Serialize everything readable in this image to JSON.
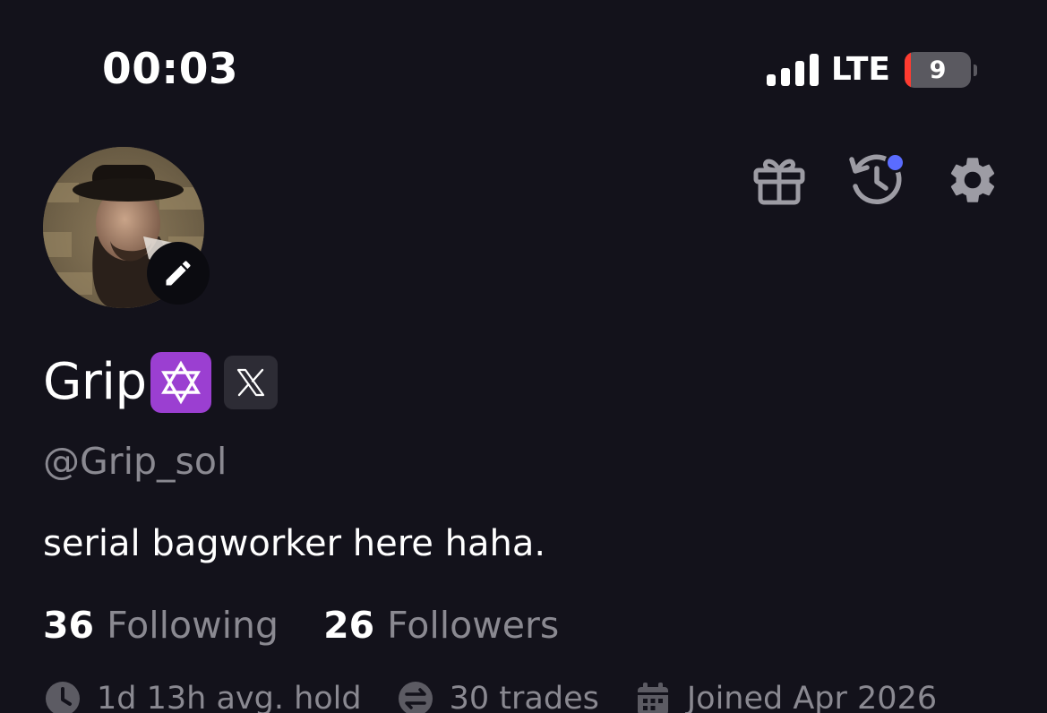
{
  "status_bar": {
    "time": "00:03",
    "network": "LTE",
    "battery_level": "9",
    "battery_fraction": 0.09,
    "battery_low_color": "#ff3b30"
  },
  "header_icons": {
    "gift": "gift-icon",
    "history": "history-icon",
    "history_has_notification": true,
    "notification_color": "#5a6cff",
    "settings": "gear-icon"
  },
  "profile": {
    "avatar": "avatar-photo",
    "name": "Grip",
    "name_badge": "star-of-david-emoji",
    "social_link": "x-logo",
    "handle": "@Grip_sol",
    "bio": "serial bagworker here haha."
  },
  "stats": {
    "following_count": "36",
    "following_label": "Following",
    "followers_count": "26",
    "followers_label": "Followers"
  },
  "meta": {
    "avg_hold": "1d 13h avg. hold",
    "trades": "30 trades",
    "joined": "Joined Apr 2026"
  }
}
